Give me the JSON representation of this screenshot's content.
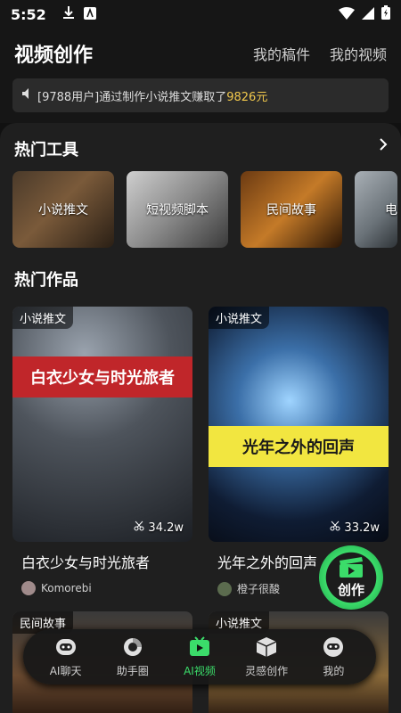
{
  "status_bar": {
    "time": "5:52"
  },
  "header": {
    "title": "视频创作",
    "links": [
      "我的稿件",
      "我的视频"
    ]
  },
  "notice": {
    "prefix": "[9788用户]通过制作小说推文赚取了",
    "amount": "9826元"
  },
  "hot_tools": {
    "title": "热门工具",
    "items": [
      {
        "label": "小说推文"
      },
      {
        "label": "短视频脚本"
      },
      {
        "label": "民间故事"
      },
      {
        "label": "电"
      }
    ]
  },
  "hot_works": {
    "title": "热门作品",
    "items": [
      {
        "tag": "小说推文",
        "cover_text": "白衣少女与时光旅者",
        "count": "34.2w",
        "title": "白衣少女与时光旅者",
        "author": "Komorebi"
      },
      {
        "tag": "小说推文",
        "cover_text": "光年之外的回声",
        "count": "33.2w",
        "title": "光年之外的回声",
        "author": "橙子很酸"
      }
    ],
    "lower_tags": [
      "民间故事",
      "小说推文"
    ]
  },
  "create_button": {
    "label": "创作"
  },
  "bottom_nav": {
    "items": [
      {
        "label": "AI聊天",
        "icon": "robot-icon"
      },
      {
        "label": "助手圈",
        "icon": "ring-icon"
      },
      {
        "label": "AI视频",
        "icon": "play-icon",
        "active": true
      },
      {
        "label": "灵感创作",
        "icon": "cube-icon"
      },
      {
        "label": "我的",
        "icon": "profile-icon"
      }
    ]
  },
  "colors": {
    "accent": "#3bdc6a",
    "highlight": "#f2c94c",
    "background": "#1f1f1f"
  }
}
